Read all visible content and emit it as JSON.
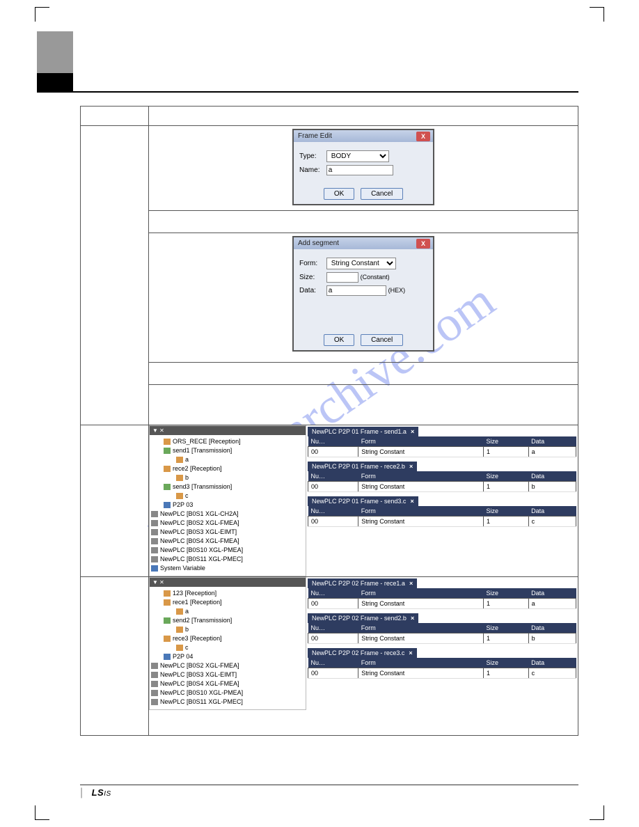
{
  "watermark": "manualsarchive.com",
  "dialog1": {
    "title": "Frame Edit",
    "type_label": "Type:",
    "type_value": "BODY",
    "name_label": "Name:",
    "name_value": "a",
    "ok": "OK",
    "cancel": "Cancel"
  },
  "dialog2": {
    "title": "Add segment",
    "form_label": "Form:",
    "form_value": "String Constant",
    "size_label": "Size:",
    "size_hint": "(Constant)",
    "data_label": "Data:",
    "data_value": "a",
    "data_hint": "(HEX)",
    "ok": "OK",
    "cancel": "Cancel"
  },
  "panel1": {
    "tree": [
      "ORS_RECE [Reception]",
      "send1 [Transmission]",
      "a",
      "rece2 [Reception]",
      "b",
      "send3 [Transmission]",
      "c",
      "P2P 03",
      "NewPLC [B0S1 XGL-CH2A]",
      "NewPLC [B0S2 XGL-FMEA]",
      "NewPLC [B0S3 XGL-EIMT]",
      "NewPLC [B0S4 XGL-FMEA]",
      "NewPLC [B0S10 XGL-PMEA]",
      "NewPLC [B0S11 XGL-PMEC]",
      "System Variable"
    ],
    "tables": [
      {
        "tab": "NewPLC P2P 01 Frame - send1.a",
        "cols": [
          "Nu…",
          "Form",
          "Size",
          "Data"
        ],
        "row": [
          "00",
          "String Constant",
          "1",
          "a"
        ]
      },
      {
        "tab": "NewPLC P2P 01 Frame - rece2.b",
        "cols": [
          "Nu…",
          "Form",
          "Size",
          "Data"
        ],
        "row": [
          "00",
          "String Constant",
          "1",
          "b"
        ]
      },
      {
        "tab": "NewPLC P2P 01 Frame - send3.c",
        "cols": [
          "Nu…",
          "Form",
          "Size",
          "Data"
        ],
        "row": [
          "00",
          "String Constant",
          "1",
          "c"
        ]
      }
    ]
  },
  "panel2": {
    "tree": [
      "123 [Reception]",
      "rece1 [Reception]",
      "a",
      "send2 [Transmission]",
      "b",
      "rece3 [Reception]",
      "c",
      "P2P 04",
      "NewPLC [B0S2 XGL-FMEA]",
      "NewPLC [B0S3 XGL-EIMT]",
      "NewPLC [B0S4 XGL-FMEA]",
      "NewPLC [B0S10 XGL-PMEA]",
      "NewPLC [B0S11 XGL-PMEC]"
    ],
    "tables": [
      {
        "tab": "NewPLC P2P 02 Frame - rece1.a",
        "cols": [
          "Nu…",
          "Form",
          "Size",
          "Data"
        ],
        "row": [
          "00",
          "String Constant",
          "1",
          "a"
        ]
      },
      {
        "tab": "NewPLC P2P 02 Frame - send2.b",
        "cols": [
          "Nu…",
          "Form",
          "Size",
          "Data"
        ],
        "row": [
          "00",
          "String Constant",
          "1",
          "b"
        ]
      },
      {
        "tab": "NewPLC P2P 02 Frame - rece3.c",
        "cols": [
          "Nu…",
          "Form",
          "Size",
          "Data"
        ],
        "row": [
          "00",
          "String Constant",
          "1",
          "c"
        ]
      }
    ]
  },
  "footer": {
    "brand": "LS",
    "suffix": "IS"
  }
}
